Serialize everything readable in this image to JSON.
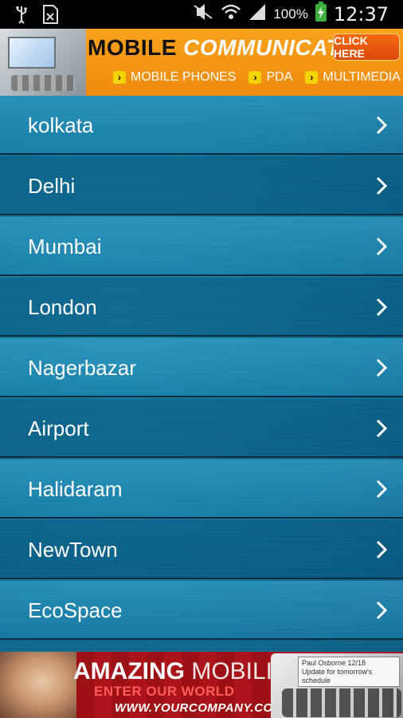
{
  "status_bar": {
    "battery_percent": "100%",
    "time": "12:37",
    "left_icons": [
      "usb-icon",
      "sim-card-icon"
    ],
    "right_icons": [
      "mute-icon",
      "wifi-icon",
      "signal-icon",
      "battery-charging-icon"
    ]
  },
  "ad_top": {
    "title_word1": "MOBILE",
    "title_word2": "COMMUNICATIONS",
    "cta_label": "CLICK HERE",
    "links": [
      "MOBILE PHONES",
      "PDA",
      "MULTIMEDIA"
    ]
  },
  "list": {
    "items": [
      {
        "label": "kolkata"
      },
      {
        "label": "Delhi"
      },
      {
        "label": "Mumbai"
      },
      {
        "label": "London"
      },
      {
        "label": "Nagerbazar"
      },
      {
        "label": "Airport"
      },
      {
        "label": "Halidaram"
      },
      {
        "label": "NewTown"
      },
      {
        "label": "EcoSpace"
      }
    ]
  },
  "ad_bottom": {
    "headline_bold": "AMAZING",
    "headline_light": "MOBILITY",
    "tagline": "ENTER OUR WORLD",
    "url": "WWW.YOURCOMPANY.COM",
    "phone_screen_line1": "Paul Osborne   12/18",
    "phone_screen_line2": "Update for tomorrow's schedule"
  }
}
